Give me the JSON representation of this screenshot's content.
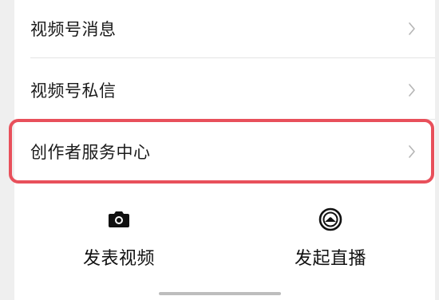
{
  "menu": {
    "items": [
      {
        "label": "视频号消息"
      },
      {
        "label": "视频号私信"
      },
      {
        "label": "创作者服务中心"
      }
    ]
  },
  "highlight_color": "#e8505b",
  "actions": {
    "post_video": {
      "label": "发表视频",
      "icon": "camera-icon"
    },
    "start_live": {
      "label": "发起直播",
      "icon": "live-broadcast-icon"
    }
  }
}
